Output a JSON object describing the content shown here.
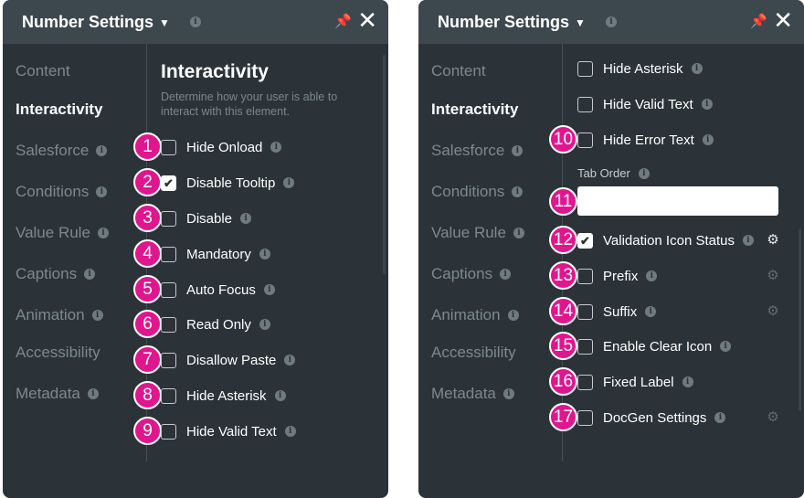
{
  "left_panel": {
    "title": "Number Settings",
    "nav": [
      {
        "label": "Content",
        "info": false,
        "active": false
      },
      {
        "label": "Interactivity",
        "info": false,
        "active": true
      },
      {
        "label": "Salesforce",
        "info": true,
        "active": false
      },
      {
        "label": "Conditions",
        "info": true,
        "active": false
      },
      {
        "label": "Value Rule",
        "info": true,
        "active": false
      },
      {
        "label": "Captions",
        "info": true,
        "active": false
      },
      {
        "label": "Animation",
        "info": true,
        "active": false
      },
      {
        "label": "Accessibility",
        "info": false,
        "active": false
      },
      {
        "label": "Metadata",
        "info": true,
        "active": false
      }
    ],
    "section_title": "Interactivity",
    "section_desc": "Determine how your user is able to interact with this element.",
    "options": [
      {
        "badge": "1",
        "label": "Hide Onload",
        "checked": false
      },
      {
        "badge": "2",
        "label": "Disable Tooltip",
        "checked": true
      },
      {
        "badge": "3",
        "label": "Disable",
        "checked": false
      },
      {
        "badge": "4",
        "label": "Mandatory",
        "checked": false
      },
      {
        "badge": "5",
        "label": "Auto Focus",
        "checked": false
      },
      {
        "badge": "6",
        "label": "Read Only",
        "checked": false
      },
      {
        "badge": "7",
        "label": "Disallow Paste",
        "checked": false
      },
      {
        "badge": "8",
        "label": "Hide Asterisk",
        "checked": false
      },
      {
        "badge": "9",
        "label": "Hide Valid Text",
        "checked": false
      }
    ]
  },
  "right_panel": {
    "title": "Number Settings",
    "nav": [
      {
        "label": "Content",
        "info": false,
        "active": false
      },
      {
        "label": "Interactivity",
        "info": false,
        "active": true
      },
      {
        "label": "Salesforce",
        "info": true,
        "active": false
      },
      {
        "label": "Conditions",
        "info": true,
        "active": false
      },
      {
        "label": "Value Rule",
        "info": true,
        "active": false
      },
      {
        "label": "Captions",
        "info": true,
        "active": false
      },
      {
        "label": "Animation",
        "info": true,
        "active": false
      },
      {
        "label": "Accessibility",
        "info": false,
        "active": false
      },
      {
        "label": "Metadata",
        "info": true,
        "active": false
      }
    ],
    "options_top": [
      {
        "badge": "",
        "label": "Hide Asterisk",
        "checked": false
      },
      {
        "badge": "",
        "label": "Hide Valid Text",
        "checked": false
      },
      {
        "badge": "10",
        "label": "Hide Error Text",
        "checked": false
      }
    ],
    "tab_order": {
      "label": "Tab Order",
      "badge": "11",
      "value": ""
    },
    "options_bottom": [
      {
        "badge": "12",
        "label": "Validation Icon Status",
        "checked": true,
        "gear": "on"
      },
      {
        "badge": "13",
        "label": "Prefix",
        "checked": false,
        "gear": "off"
      },
      {
        "badge": "14",
        "label": "Suffix",
        "checked": false,
        "gear": "off"
      },
      {
        "badge": "15",
        "label": "Enable Clear Icon",
        "checked": false,
        "gear": null
      },
      {
        "badge": "16",
        "label": "Fixed Label",
        "checked": false,
        "gear": null
      },
      {
        "badge": "17",
        "label": "DocGen Settings",
        "checked": false,
        "gear": "off"
      }
    ]
  },
  "icons": {
    "chevron": "chevron-down-icon",
    "info": "info-icon",
    "pin": "pin-icon",
    "close": "close-icon",
    "gear": "gear-icon",
    "check": "checkmark-icon"
  },
  "colors": {
    "panel_bg": "#2b3338",
    "header_bg": "#3d484e",
    "badge": "#e0168e",
    "text_muted": "#7d898f"
  }
}
